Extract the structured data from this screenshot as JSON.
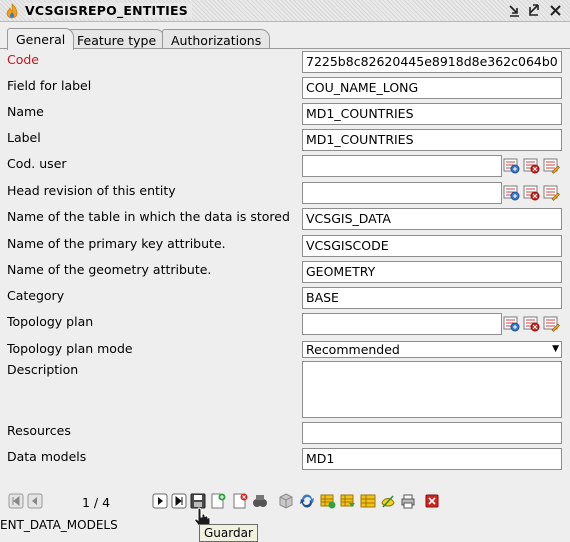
{
  "window": {
    "title": "VCSGISREPO_ENTITIES"
  },
  "tabs": [
    {
      "label": "General",
      "active": true
    },
    {
      "label": "Feature type",
      "active": false
    },
    {
      "label": "Authorizations",
      "active": false
    }
  ],
  "fields": {
    "code": {
      "label": "Code",
      "value": "7225b8c82620445e8918d8e362c064b0"
    },
    "field_for_label": {
      "label": "Field for label",
      "value": "COU_NAME_LONG"
    },
    "name": {
      "label": "Name",
      "value": "MD1_COUNTRIES"
    },
    "label": {
      "label": "Label",
      "value": "MD1_COUNTRIES"
    },
    "cod_user": {
      "label": "Cod. user",
      "value": ""
    },
    "head_revision": {
      "label": "Head revision of this entity",
      "value": ""
    },
    "table_name": {
      "label": "Name of the table in which the data is stored",
      "value": "VCSGIS_DATA"
    },
    "primary_key": {
      "label": "Name of the primary key attribute.",
      "value": "VCSGISCODE"
    },
    "geometry_attr": {
      "label": "Name of the geometry attribute.",
      "value": "GEOMETRY"
    },
    "category": {
      "label": "Category",
      "value": "BASE"
    },
    "topology_plan": {
      "label": "Topology plan",
      "value": ""
    },
    "topology_plan_mode": {
      "label": "Topology plan mode",
      "value": "Recommended"
    },
    "description": {
      "label": "Description",
      "value": ""
    },
    "resources": {
      "label": "Resources",
      "value": ""
    },
    "data_models": {
      "label": "Data models",
      "value": "MD1"
    }
  },
  "toolbar": {
    "pager": "1 / 4"
  },
  "footer": {
    "text": "ENT_DATA_MODELS"
  },
  "tooltip": {
    "text": "Guardar"
  },
  "colors": {
    "required_label": "#c8141e",
    "accent_blue": "#3a78c8"
  }
}
